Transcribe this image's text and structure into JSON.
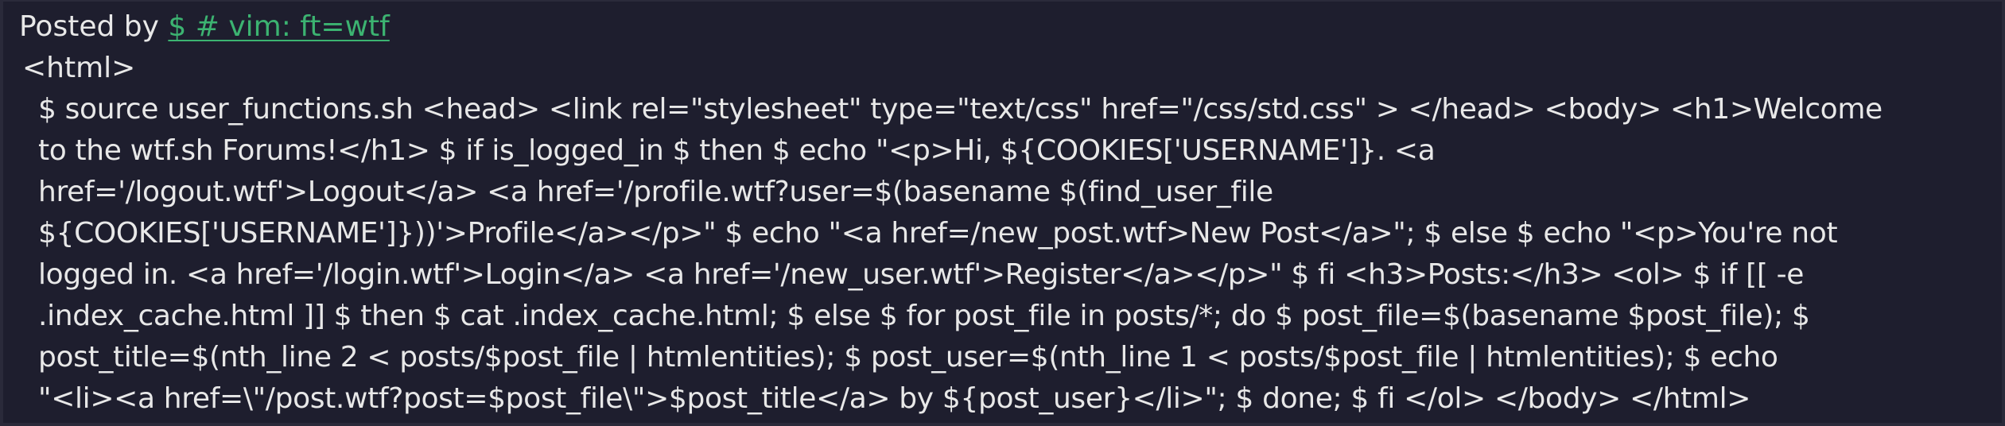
{
  "post": {
    "posted_by_label": "Posted by",
    "author_link": "$ # vim: ft=wtf",
    "opening_tag": "<html>",
    "body_lines": [
      "$ source user_functions.sh <head> <link rel=\"stylesheet\" type=\"text/css\" href=\"/css/std.css\" > </head> <body> <h1>Welcome",
      "to the wtf.sh Forums!</h1> $ if is_logged_in $ then $ echo \"<p>Hi, ${COOKIES['USERNAME']}. <a",
      "href='/logout.wtf'>Logout</a> <a href='/profile.wtf?user=$(basename $(find_user_file",
      "${COOKIES['USERNAME']}))'>Profile</a></p>\" $ echo \"<a href=/new_post.wtf>New Post</a>\"; $ else $ echo \"<p>You're not",
      "logged in. <a href='/login.wtf'>Login</a> <a href='/new_user.wtf'>Register</a></p>\" $ fi <h3>Posts:</h3> <ol> $ if [[ -e",
      ".index_cache.html ]] $ then $ cat .index_cache.html; $ else $ for post_file in posts/*; do $ post_file=$(basename $post_file); $",
      "post_title=$(nth_line 2 < posts/$post_file | htmlentities); $ post_user=$(nth_line 1 < posts/$post_file | htmlentities); $ echo",
      "\"<li><a href=\\\"/post.wtf?post=$post_file\\\">$post_title</a> by ${post_user}</li>\"; $ done; $ fi </ol> </body> </html>"
    ]
  },
  "colors": {
    "background": "#1e1e2e",
    "text": "#e8e8e8",
    "link": "#3cb371"
  }
}
